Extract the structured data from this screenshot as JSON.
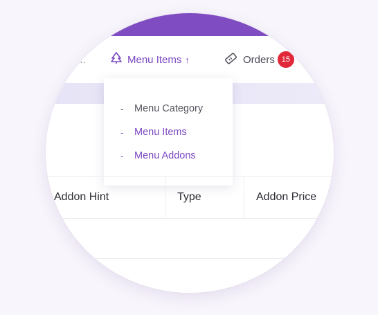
{
  "nav": {
    "cut_item": "…",
    "menu_items": {
      "label": "Menu Items",
      "arrow": "↑",
      "icon": "tree-icon"
    },
    "orders": {
      "label": "Orders",
      "badge": "15",
      "icon": "ticket-icon"
    }
  },
  "dropdown": {
    "items": [
      {
        "label": "Menu Category",
        "dash": "-"
      },
      {
        "label": "Menu Items",
        "dash": "-"
      },
      {
        "label": "Menu Addons",
        "dash": "-"
      }
    ]
  },
  "table": {
    "headers": [
      "Addon Hint",
      "Type",
      "Addon Price"
    ]
  },
  "colors": {
    "accent": "#7f4cc2",
    "badge": "#e0283a",
    "band": "#e7e4f7"
  }
}
